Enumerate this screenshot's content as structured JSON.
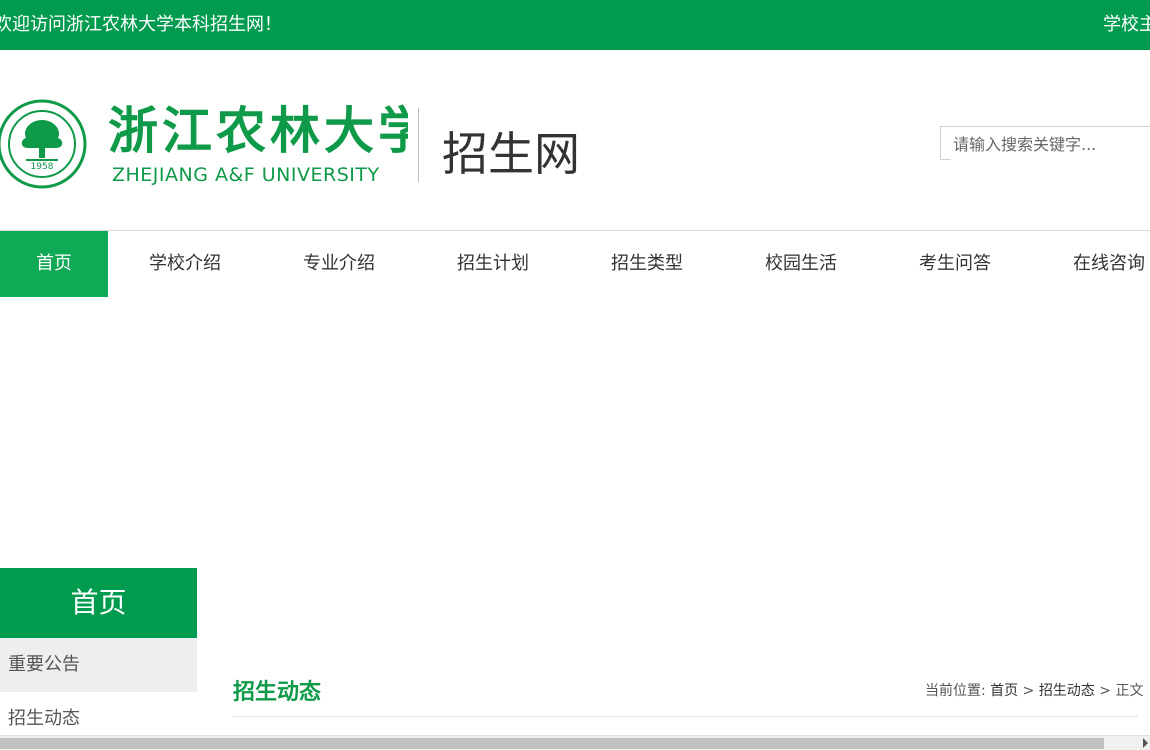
{
  "topbar": {
    "welcome": "欢迎访问浙江农林大学本科招生网！",
    "right_link": "学校主"
  },
  "header": {
    "logo_cn": "浙江农林大学",
    "logo_en": "ZHEJIANG A&F UNIVERSITY",
    "emblem_year": "1958",
    "site_name": "招生网",
    "search_placeholder": "请输入搜索关键字..."
  },
  "nav": {
    "items": [
      {
        "label": "首页",
        "active": true
      },
      {
        "label": "学校介绍"
      },
      {
        "label": "专业介绍"
      },
      {
        "label": "招生计划"
      },
      {
        "label": "招生类型"
      },
      {
        "label": "校园生活"
      },
      {
        "label": "考生问答"
      },
      {
        "label": "在线咨询"
      }
    ]
  },
  "sidebar": {
    "title": "首页",
    "items": [
      {
        "label": "重要公告"
      },
      {
        "label": "招生动态"
      }
    ]
  },
  "content": {
    "title": "招生动态",
    "breadcrumb": {
      "prefix": "当前位置:",
      "home": "首页",
      "sep1": ">",
      "section": "招生动态",
      "sep2": ">",
      "current": "正文"
    }
  },
  "colors": {
    "brand_green": "#009b4f",
    "nav_active": "#10a956",
    "logo_green": "#0e9a48"
  }
}
